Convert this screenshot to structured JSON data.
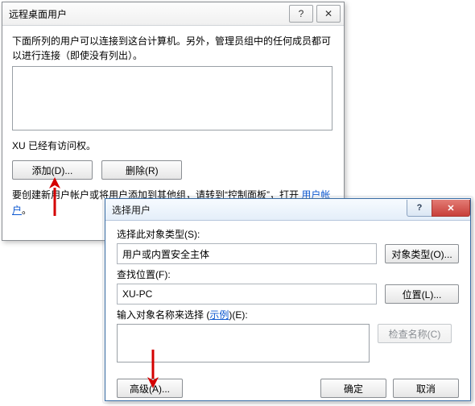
{
  "w1": {
    "title": "远程桌面用户",
    "help_glyph": "?",
    "close_glyph": "✕",
    "info": "下面所列的用户可以连接到这台计算机。另外，管理员组中的任何成员都可以进行连接（即使没有列出）。",
    "access_line": "XU 已经有访问权。",
    "add_btn": "添加(D)...",
    "remove_btn": "删除(R)",
    "create_pre": "要创建新用户帐户或将用户添加到其他组，请转到“控制面板”，打开 ",
    "create_link": "用户帐户",
    "create_post": "。"
  },
  "w2": {
    "title": "选择用户",
    "help_glyph": "?",
    "close_glyph": "✕",
    "object_type_label": "选择此对象类型(S):",
    "object_type_value": "用户或内置安全主体",
    "object_type_btn": "对象类型(O)...",
    "location_label": "查找位置(F):",
    "location_value": "XU-PC",
    "location_btn": "位置(L)...",
    "names_label_pre": "输入对象名称来选择 (",
    "names_label_link": "示例",
    "names_label_post": ")(E):",
    "check_names_btn": "检查名称(C)",
    "advanced_btn": "高级(A)...",
    "ok_btn": "确定",
    "cancel_btn": "取消"
  }
}
